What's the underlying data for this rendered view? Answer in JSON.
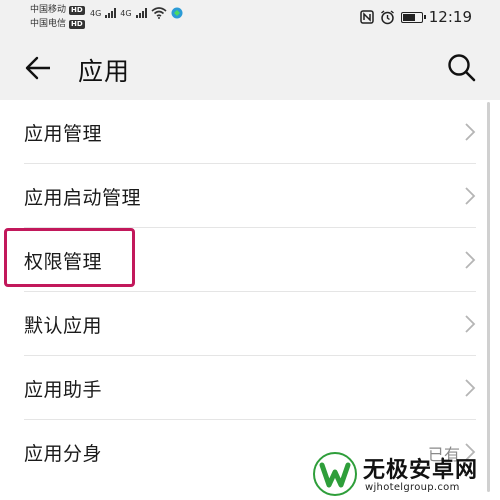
{
  "status_bar": {
    "carrier1": "中国移动",
    "carrier2": "中国电信",
    "hd_badge": "HD",
    "net_type": "4G",
    "time": "12:19",
    "battery_level": 0.7,
    "icons": [
      "nfc-icon",
      "alarm-icon",
      "wifi-icon",
      "battery-icon"
    ]
  },
  "app_bar": {
    "title": "应用"
  },
  "list": {
    "items": [
      {
        "label": "应用管理",
        "value": ""
      },
      {
        "label": "应用启动管理",
        "value": ""
      },
      {
        "label": "权限管理",
        "value": ""
      },
      {
        "label": "默认应用",
        "value": ""
      },
      {
        "label": "应用助手",
        "value": ""
      },
      {
        "label": "应用分身",
        "value": "已有"
      }
    ]
  },
  "watermark": {
    "title": "无极安卓网",
    "url": "wjhotelgroup.com"
  },
  "colors": {
    "highlight": "#c2185b",
    "logo_green": "#2e9e3a",
    "background": "#f1f1f1"
  }
}
